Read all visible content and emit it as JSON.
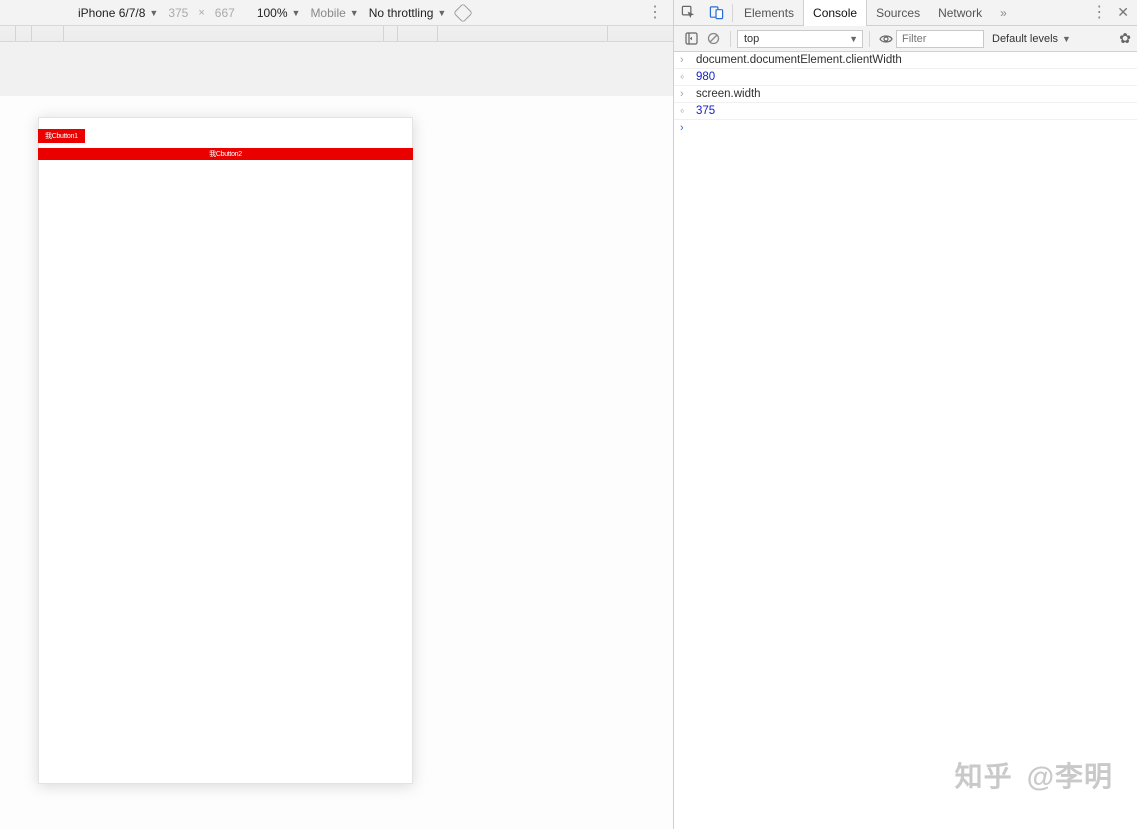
{
  "device_toolbar": {
    "device_name": "iPhone 6/7/8",
    "width": "375",
    "height": "667",
    "zoom": "100%",
    "ua_mode": "Mobile",
    "throttling": "No throttling"
  },
  "device_canvas": {
    "btn1_label": "我Cbutton1",
    "btn2_label": "我Cbutton2"
  },
  "devtools": {
    "tabs": {
      "elements": "Elements",
      "console": "Console",
      "sources": "Sources",
      "network": "Network"
    },
    "console_toolbar": {
      "context": "top",
      "filter_placeholder": "Filter",
      "levels": "Default levels"
    },
    "console_lines": {
      "l0": "document.documentElement.clientWidth",
      "l1": "980",
      "l2": "screen.width",
      "l3": "375"
    }
  },
  "watermark": {
    "logo": "知乎",
    "author": "@李明"
  }
}
